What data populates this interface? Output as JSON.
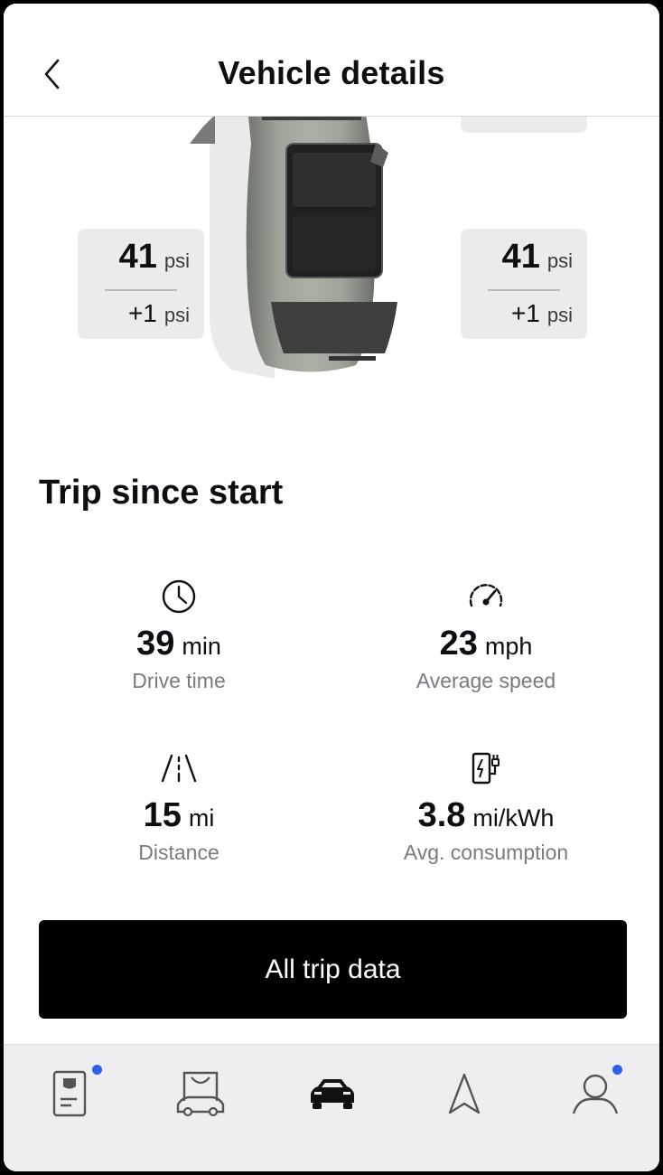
{
  "header": {
    "title": "Vehicle details",
    "back_icon": "chevron-left-icon"
  },
  "tires": {
    "front_left": {
      "pressure": "41",
      "unit": "psi",
      "delta": "+1",
      "delta_unit": "psi"
    },
    "front_right": {
      "pressure": "41",
      "unit": "psi",
      "delta": "+1",
      "delta_unit": "psi"
    }
  },
  "trip": {
    "title": "Trip since start",
    "stats": [
      {
        "icon": "clock-icon",
        "value": "39",
        "unit": "min",
        "label": "Drive time"
      },
      {
        "icon": "speedometer-icon",
        "value": "23",
        "unit": "mph",
        "label": "Average speed"
      },
      {
        "icon": "road-icon",
        "value": "15",
        "unit": "mi",
        "label": "Distance"
      },
      {
        "icon": "charging-station-icon",
        "value": "3.8",
        "unit": "mi/kWh",
        "label": "Avg. consumption"
      }
    ]
  },
  "cta": {
    "label": "All trip data"
  },
  "bottom_nav": {
    "items": [
      {
        "icon": "document-card-icon",
        "notification": true
      },
      {
        "icon": "car-garage-icon",
        "notification": false
      },
      {
        "icon": "car-icon",
        "active": true,
        "notification": false
      },
      {
        "icon": "navigation-icon",
        "notification": false
      },
      {
        "icon": "user-icon",
        "notification": true
      }
    ]
  },
  "colors": {
    "notification_dot": "#2d63e8",
    "button_bg": "#000000",
    "tile_bg": "#ebebed"
  }
}
